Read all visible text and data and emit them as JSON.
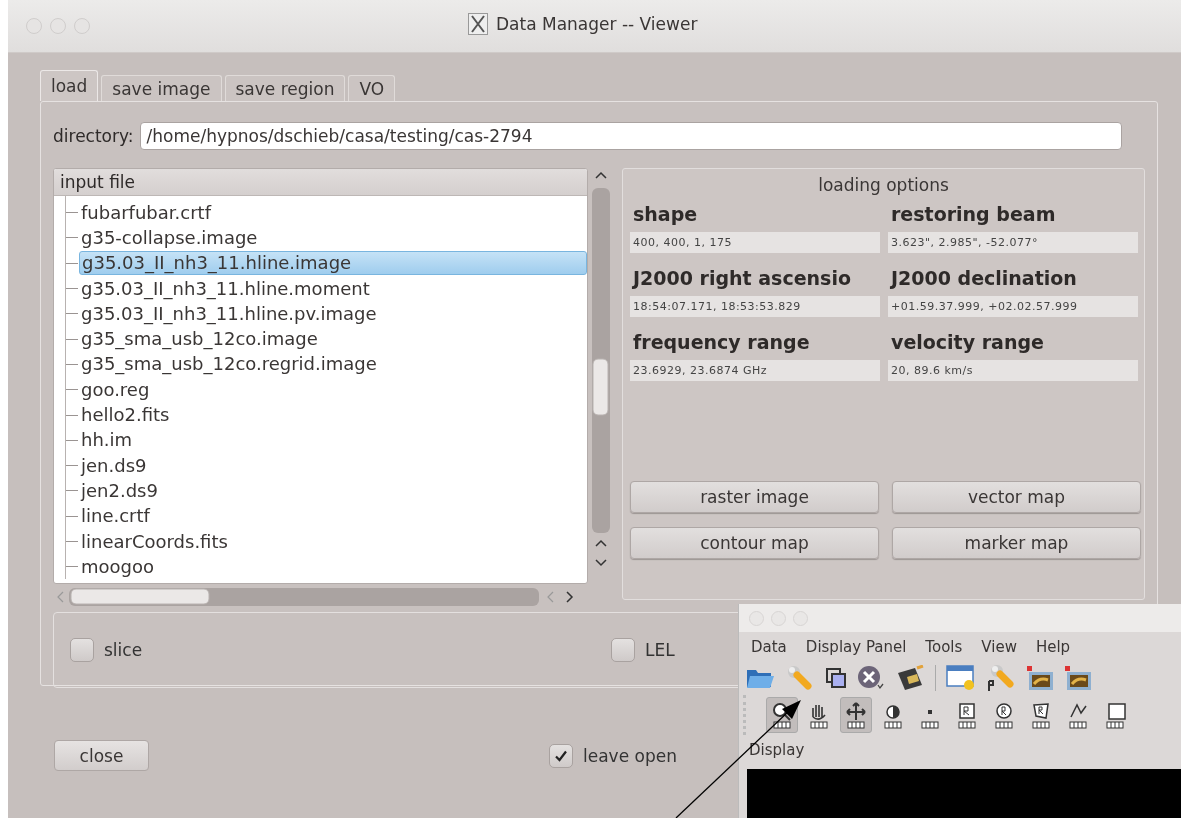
{
  "window": {
    "title": "Data Manager -- Viewer"
  },
  "tabs": [
    {
      "label": "load",
      "selected": true
    },
    {
      "label": "save image",
      "selected": false
    },
    {
      "label": "save region",
      "selected": false
    },
    {
      "label": "VO",
      "selected": false
    }
  ],
  "directory": {
    "label": "directory:",
    "value": "/home/hypnos/dschieb/casa/testing/cas-2794"
  },
  "file_list": {
    "header": "input file",
    "items": [
      {
        "name": "fubarfubar.crtf",
        "selected": false
      },
      {
        "name": "g35-collapse.image",
        "selected": false
      },
      {
        "name": "g35.03_II_nh3_11.hline.image",
        "selected": true
      },
      {
        "name": "g35.03_II_nh3_11.hline.moment",
        "selected": false
      },
      {
        "name": "g35.03_II_nh3_11.hline.pv.image",
        "selected": false
      },
      {
        "name": "g35_sma_usb_12co.image",
        "selected": false
      },
      {
        "name": "g35_sma_usb_12co.regrid.image",
        "selected": false
      },
      {
        "name": "goo.reg",
        "selected": false
      },
      {
        "name": "hello2.fits",
        "selected": false
      },
      {
        "name": "hh.im",
        "selected": false
      },
      {
        "name": "jen.ds9",
        "selected": false
      },
      {
        "name": "jen2.ds9",
        "selected": false
      },
      {
        "name": "line.crtf",
        "selected": false
      },
      {
        "name": "linearCoords.fits",
        "selected": false
      },
      {
        "name": "moogoo",
        "selected": false
      }
    ]
  },
  "loading_options": {
    "title": "loading options",
    "fields": [
      {
        "label": "shape",
        "value": "400, 400, 1, 175"
      },
      {
        "label": "restoring beam",
        "value": "3.623\", 2.985\", -52.077°"
      },
      {
        "label": "J2000 right ascensio",
        "value": "18:54:07.171, 18:53:53.829"
      },
      {
        "label": "J2000 declination",
        "value": "+01.59.37.999, +02.02.57.999"
      },
      {
        "label": "frequency range",
        "value": "23.6929, 23.6874 GHz"
      },
      {
        "label": "velocity range",
        "value": "20, 89.6 km/s"
      }
    ],
    "buttons": [
      "raster image",
      "vector map",
      "contour map",
      "marker map"
    ]
  },
  "options": [
    {
      "label": "slice",
      "checked": false
    },
    {
      "label": "LEL",
      "checked": false
    }
  ],
  "close_button": "close",
  "leave_open": {
    "label": "leave open",
    "checked": true
  },
  "viewer": {
    "menu": [
      "Data",
      "Display Panel",
      "Tools",
      "View",
      "Help"
    ],
    "mouse_tools": [
      {
        "selected": true
      },
      {
        "selected": false
      },
      {
        "selected": true
      },
      {
        "selected": false
      },
      {
        "selected": false
      },
      {
        "selected": false
      },
      {
        "selected": false
      },
      {
        "selected": false
      },
      {
        "selected": false
      },
      {
        "selected": false
      }
    ],
    "panel_label": "Display"
  }
}
